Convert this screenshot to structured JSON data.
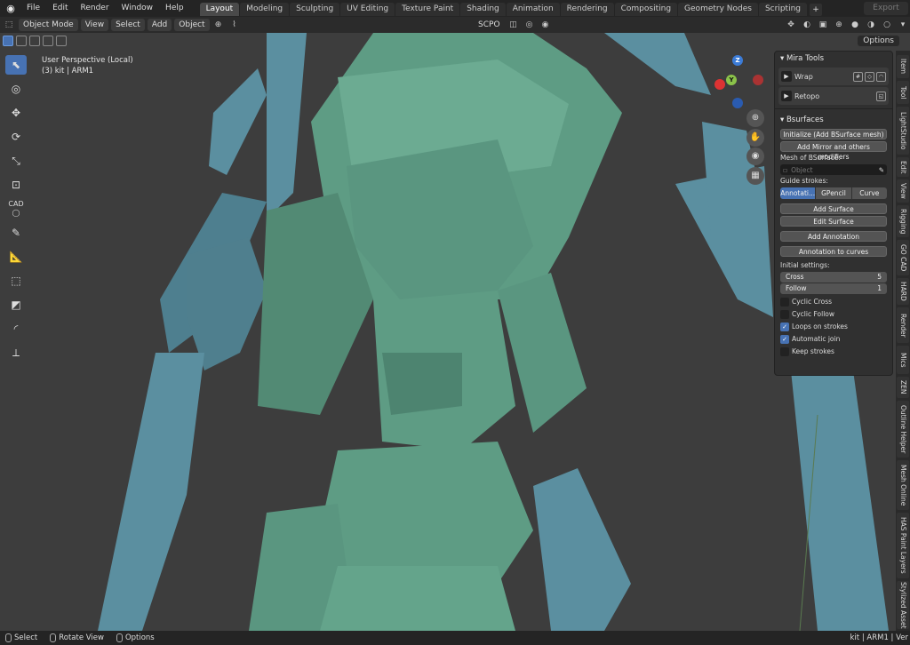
{
  "menu": [
    "File",
    "Edit",
    "Render",
    "Window",
    "Help"
  ],
  "workspaces": [
    {
      "label": "Layout",
      "active": true
    },
    {
      "label": "Modeling",
      "active": false
    },
    {
      "label": "Sculpting",
      "active": false
    },
    {
      "label": "UV Editing",
      "active": false
    },
    {
      "label": "Texture Paint",
      "active": false
    },
    {
      "label": "Shading",
      "active": false
    },
    {
      "label": "Animation",
      "active": false
    },
    {
      "label": "Rendering",
      "active": false
    },
    {
      "label": "Compositing",
      "active": false
    },
    {
      "label": "Geometry Nodes",
      "active": false
    },
    {
      "label": "Scripting",
      "active": false
    }
  ],
  "export_label": "Export",
  "header": {
    "mode": "Object Mode",
    "view": "View",
    "select": "Select",
    "add": "Add",
    "object": "Object",
    "pivot": "SCPO",
    "options": "Options"
  },
  "viewport": {
    "line1": "User Perspective (Local)",
    "line2": "(3) kit | ARM1"
  },
  "gizmo": {
    "z": "Z",
    "y": "Y"
  },
  "mira": {
    "title": "Mira Tools",
    "wrap": "Wrap",
    "retopo": "Retopo"
  },
  "bsurfaces": {
    "title": "Bsurfaces",
    "initialize": "Initialize (Add BSurface mesh)",
    "add_mirror": "Add Mirror and others modifiers",
    "mesh_label": "Mesh of BSurface:",
    "mesh_placeholder": "Object",
    "guide_label": "Guide strokes:",
    "guide_options": [
      "Annotati...",
      "GPencil",
      "Curve"
    ],
    "add_surface": "Add Surface",
    "edit_surface": "Edit Surface",
    "add_annotation": "Add Annotation",
    "annotation_to_curves": "Annotation to curves",
    "initial_label": "Initial settings:",
    "cross_label": "Cross",
    "cross_value": "5",
    "follow_label": "Follow",
    "follow_value": "1",
    "checks": [
      {
        "label": "Cyclic Cross",
        "on": false
      },
      {
        "label": "Cyclic Follow",
        "on": false
      },
      {
        "label": "Loops on strokes",
        "on": true
      },
      {
        "label": "Automatic join",
        "on": true
      },
      {
        "label": "Keep strokes",
        "on": false
      }
    ]
  },
  "ntabs": [
    "Item",
    "Tool",
    "LightStudio",
    "Edit",
    "View",
    "Rigging",
    "GO CAD",
    "HARD",
    "Render",
    "Mics",
    "ZEN",
    "Outline Helper",
    "Mesh Online",
    "HAS Paint Layers",
    "Stylized Asset"
  ],
  "status": {
    "select": "Select",
    "rotate": "Rotate View",
    "options": "Options",
    "right": "kit | ARM1 | Ver"
  },
  "colors": {
    "active_blue": "#4772b3",
    "model_green": "#5e9c84",
    "model_teal": "#5b8fa0",
    "background": "#3d3d3d"
  }
}
